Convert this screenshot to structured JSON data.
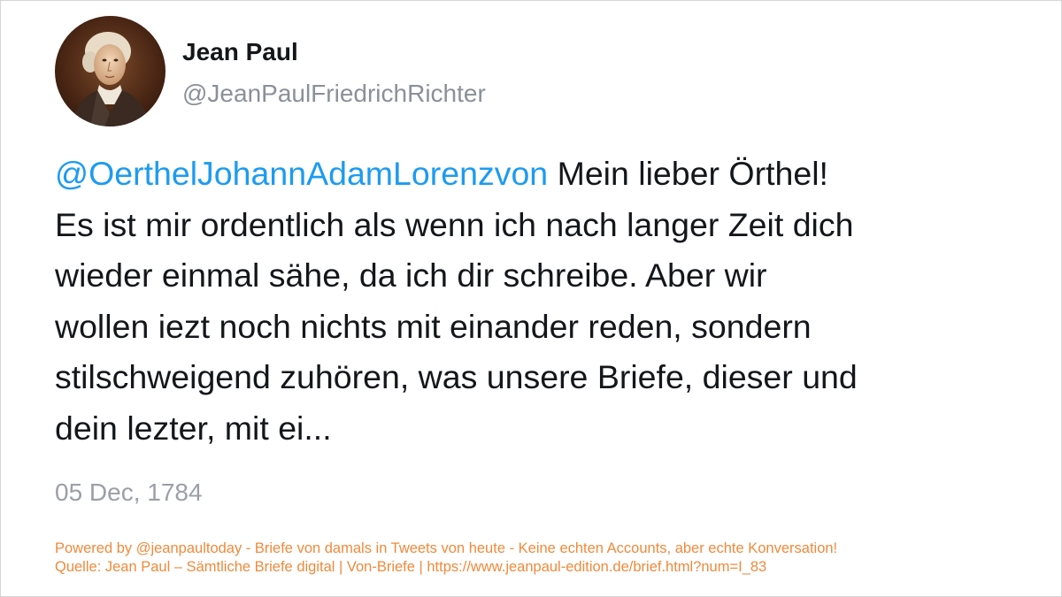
{
  "author": {
    "display_name": "Jean Paul",
    "handle": "@JeanPaulFriedrichRichter",
    "avatar_icon": "portrait-avatar"
  },
  "tweet": {
    "mention": "@OerthelJohannAdamLorenzvon",
    "text": " Mein lieber Örthel!\nEs ist mir ordentlich als wenn ich nach langer Zeit dich\nwieder einmal sähe, da ich dir schreibe. Aber wir\nwollen iezt noch nichts mit einander reden, sondern\nstilschweigend zuhören, was unsere Briefe, dieser und\ndein lezter, mit ei...",
    "date": "05 Dec, 1784"
  },
  "footer": {
    "line1": "Powered by @jeanpaultoday - Briefe von damals in Tweets von heute - Keine echten Accounts, aber echte Konversation!",
    "line2": "Quelle: Jean Paul – Sämtliche Briefe digital | Von-Briefe | https://www.jeanpaul-edition.de/brief.html?num=I_83"
  },
  "colors": {
    "mention": "#1d9bf0",
    "text": "#14171a",
    "muted": "#8a9098",
    "footer": "#f08a3c",
    "border": "#d5d5d5"
  }
}
